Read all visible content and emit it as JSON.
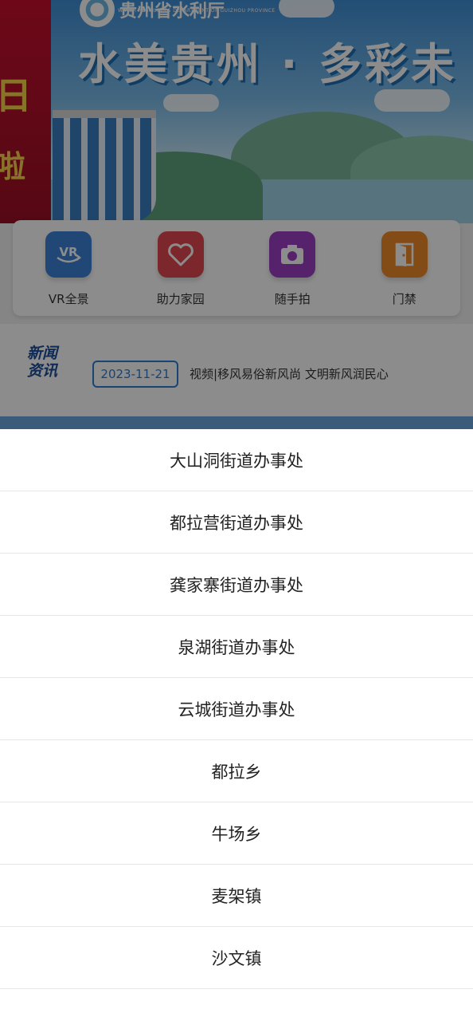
{
  "banner": {
    "logo_text": "贵州省水利厅",
    "logo_subtext": "WATER RESOURCES DEPARTMENT OF GUIZHOU PROVINCE",
    "title": "水美贵州 · 多彩未",
    "left_text": "日",
    "left_subtext": "啦"
  },
  "shortcuts": [
    {
      "label": "VR全景",
      "icon": "vr-icon",
      "color": "#3b82d6"
    },
    {
      "label": "助力家园",
      "icon": "heart-icon",
      "color": "#e0484f"
    },
    {
      "label": "随手拍",
      "icon": "camera-icon",
      "color": "#9b3fc4"
    },
    {
      "label": "门禁",
      "icon": "door-icon",
      "color": "#ee8a2a"
    }
  ],
  "news": {
    "logo_line1": "新闻",
    "logo_line2": "资讯",
    "date": "2023-11-21",
    "headline": "视频|移风易俗新风尚 文明新风润民心"
  },
  "picker": {
    "options": [
      "大山洞街道办事处",
      "都拉营街道办事处",
      "龚家寨街道办事处",
      "泉湖街道办事处",
      "云城街道办事处",
      "都拉乡",
      "牛场乡",
      "麦架镇",
      "沙文镇"
    ]
  }
}
